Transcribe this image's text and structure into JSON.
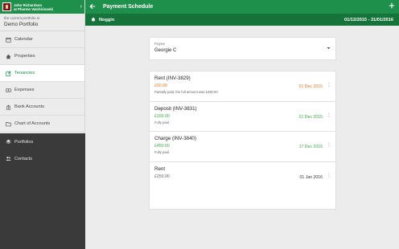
{
  "colors": {
    "primary": "#1f8f4c",
    "primary_dark": "#16743b",
    "sidebar_dark": "#3a3a3a",
    "overdue": "#e07b2a",
    "paid": "#3ea645"
  },
  "user": {
    "line1": "John Richardson",
    "line2": "at Pharmo Vatchirinoski"
  },
  "portfolio": {
    "caption": "the current portfolio is",
    "name": "Demo Portfolio"
  },
  "nav": {
    "items": [
      {
        "label": "Calendar",
        "icon": "calendar-icon"
      },
      {
        "label": "Properties",
        "icon": "home-icon"
      },
      {
        "label": "Tenancies",
        "icon": "edit-icon",
        "active": true
      },
      {
        "label": "Expenses",
        "icon": "money-icon"
      },
      {
        "label": "Bank Accounts",
        "icon": "bank-icon"
      },
      {
        "label": "Chart of Accounts",
        "icon": "folder-icon"
      }
    ],
    "dark_items": [
      {
        "label": "Portfolios",
        "icon": "layers-icon"
      },
      {
        "label": "Contacts",
        "icon": "users-icon"
      }
    ]
  },
  "header": {
    "title": "Payment Schedule",
    "back_icon": "arrow-left-icon",
    "add_icon": "plus-icon"
  },
  "subheader": {
    "property": "Noggin",
    "date_range": "01/12/2015 - 31/01/2016"
  },
  "payee": {
    "label": "Payee",
    "value": "Georgie C"
  },
  "schedule": [
    {
      "title": "Rent (INV-3829)",
      "amount": "£50.00",
      "amount_status": "orange",
      "note": "Partially paid, the full amount was £250.00",
      "date": "01 Dec 2015",
      "date_status": "orange"
    },
    {
      "title": "Deposit (INV-3831)",
      "amount": "£100.00",
      "amount_status": "green",
      "note": "Fully paid",
      "date": "01 Dec 2015",
      "date_status": "green"
    },
    {
      "title": "Charge (INV-3840)",
      "amount": "£450.00",
      "amount_status": "green",
      "note": "Fully paid",
      "date": "17 Dec 2015",
      "date_status": "green"
    },
    {
      "title": "Rent",
      "amount": "£250.00",
      "amount_status": "gray",
      "note": "",
      "date": "01 Jan 2016",
      "date_status": "dark"
    }
  ]
}
